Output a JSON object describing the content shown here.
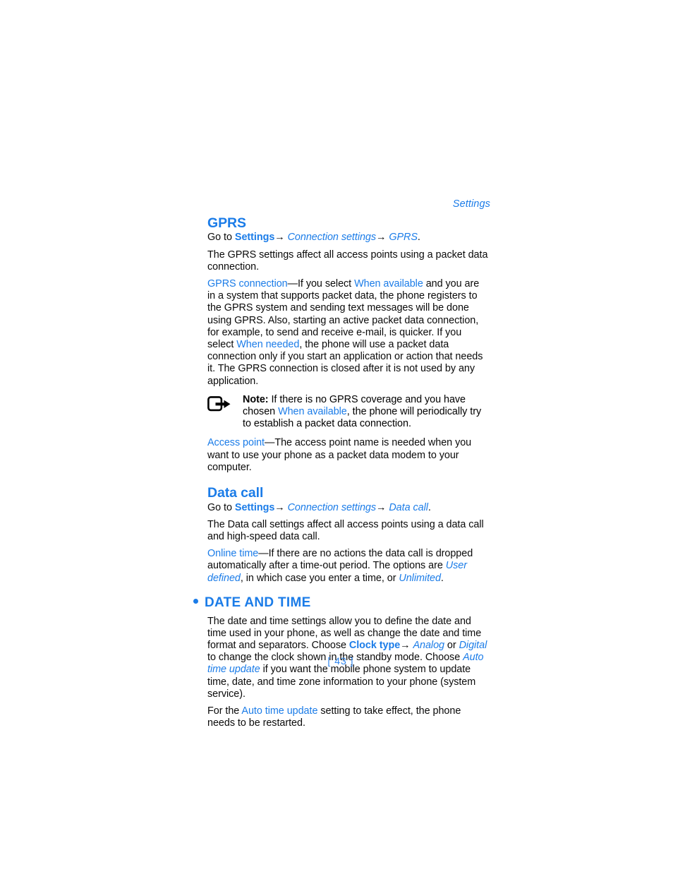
{
  "header": {
    "running_title": "Settings"
  },
  "sections": {
    "gprs": {
      "heading": "GPRS",
      "path": {
        "prefix": "Go to ",
        "app": "Settings",
        "arrow1": "→",
        "level2": "Connection settings",
        "arrow2": "→",
        "level3": "GPRS",
        "period": "."
      },
      "intro": "The GPRS settings affect all access points using a packet data connection.",
      "connection": {
        "term": "GPRS connection",
        "dash": "—If you select ",
        "opt1": "When available",
        "mid": " and you are in a system that supports packet data, the phone registers to the GPRS system and sending text messages will be done using GPRS. Also, starting an active packet data connection, for example, to send and receive e-mail, is quicker. If you select ",
        "opt2": "When needed",
        "tail": ", the phone will use a packet data connection only if you start an application or action that needs it. The GPRS connection is closed after it is not used by any application."
      },
      "note": {
        "icon": "note-arrow-icon",
        "label": "Note:",
        "text_a": " If there is no GPRS coverage and you have chosen ",
        "highlight": "When available",
        "text_b": ", the phone will periodically try to establish a packet data connection."
      },
      "access_point": {
        "term": "Access point",
        "text": "—The access point name is needed when you want to use your phone as a packet data modem to your computer."
      }
    },
    "data_call": {
      "heading": "Data call",
      "path": {
        "prefix": "Go to ",
        "app": "Settings",
        "arrow1": "→",
        "level2": "Connection settings",
        "arrow2": "→",
        "level3": "Data call",
        "period": "."
      },
      "intro": "The Data call settings affect all access points using a data call and high-speed data call.",
      "online_time": {
        "term": "Online time",
        "text_a": "—If there are no actions the data call is dropped automatically after a time-out period. The options are ",
        "opt1": "User defined",
        "text_b": ", in which case you enter a time, or ",
        "opt2": "Unlimited",
        "period": "."
      }
    },
    "date_and_time": {
      "heading": "DATE AND TIME",
      "para1_a": "The date and time settings allow you to define the date and time used in your phone, as well as change the date and time format and separators. Choose ",
      "clock_type": "Clock type",
      "arrow": "→",
      "analog": "Analog",
      "or": " or ",
      "digital": "Digital",
      "para1_b": " to change the clock shown in the standby mode. Choose ",
      "auto_time_update_1": "Auto time update",
      "para1_c": " if you want the mobile phone system to update time, date, and time zone information to your phone (system service).",
      "para2_a": "For the ",
      "auto_time_update_2": "Auto time update",
      "para2_b": " setting to take effect, the phone needs to be restarted."
    }
  },
  "footer": {
    "page_number": "[ 43 ]"
  },
  "colors": {
    "accent_blue": "#1b7ce8",
    "folio_blue": "#2f86ef",
    "body_black": "#0a0a0a"
  }
}
